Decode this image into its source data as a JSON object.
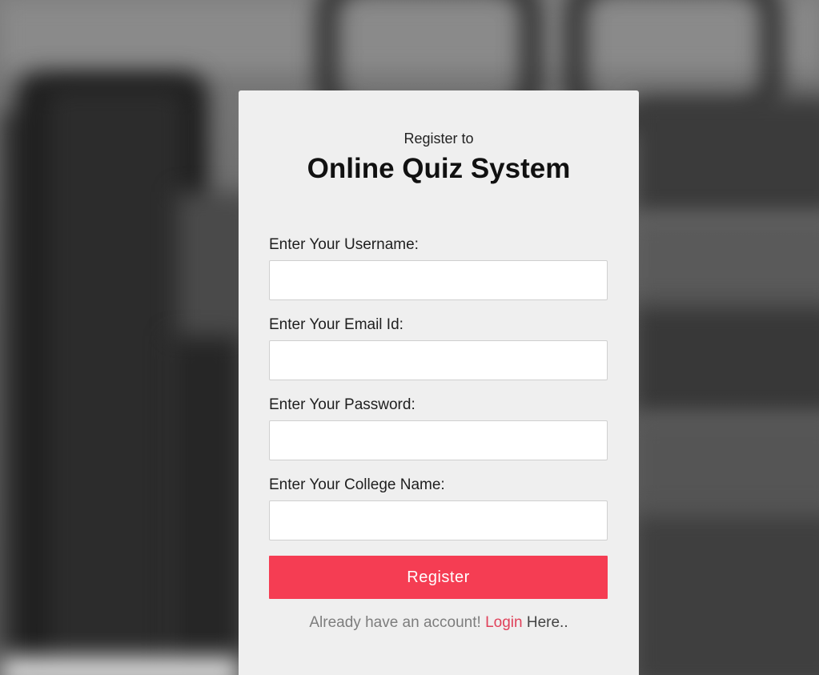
{
  "header": {
    "subtitle": "Register to",
    "title": "Online Quiz System"
  },
  "form": {
    "fields": [
      {
        "label": "Enter Your Username:",
        "value": "",
        "placeholder": ""
      },
      {
        "label": "Enter Your Email Id:",
        "value": "",
        "placeholder": ""
      },
      {
        "label": "Enter Your Password:",
        "value": "",
        "placeholder": ""
      },
      {
        "label": "Enter Your College Name:",
        "value": "",
        "placeholder": ""
      }
    ],
    "submit_label": "Register"
  },
  "footer": {
    "prompt": "Already have an account!",
    "login_label": "Login",
    "suffix": "Here.."
  },
  "colors": {
    "accent": "#f53d53",
    "card_background": "#efefef",
    "link": "#e0415a"
  }
}
